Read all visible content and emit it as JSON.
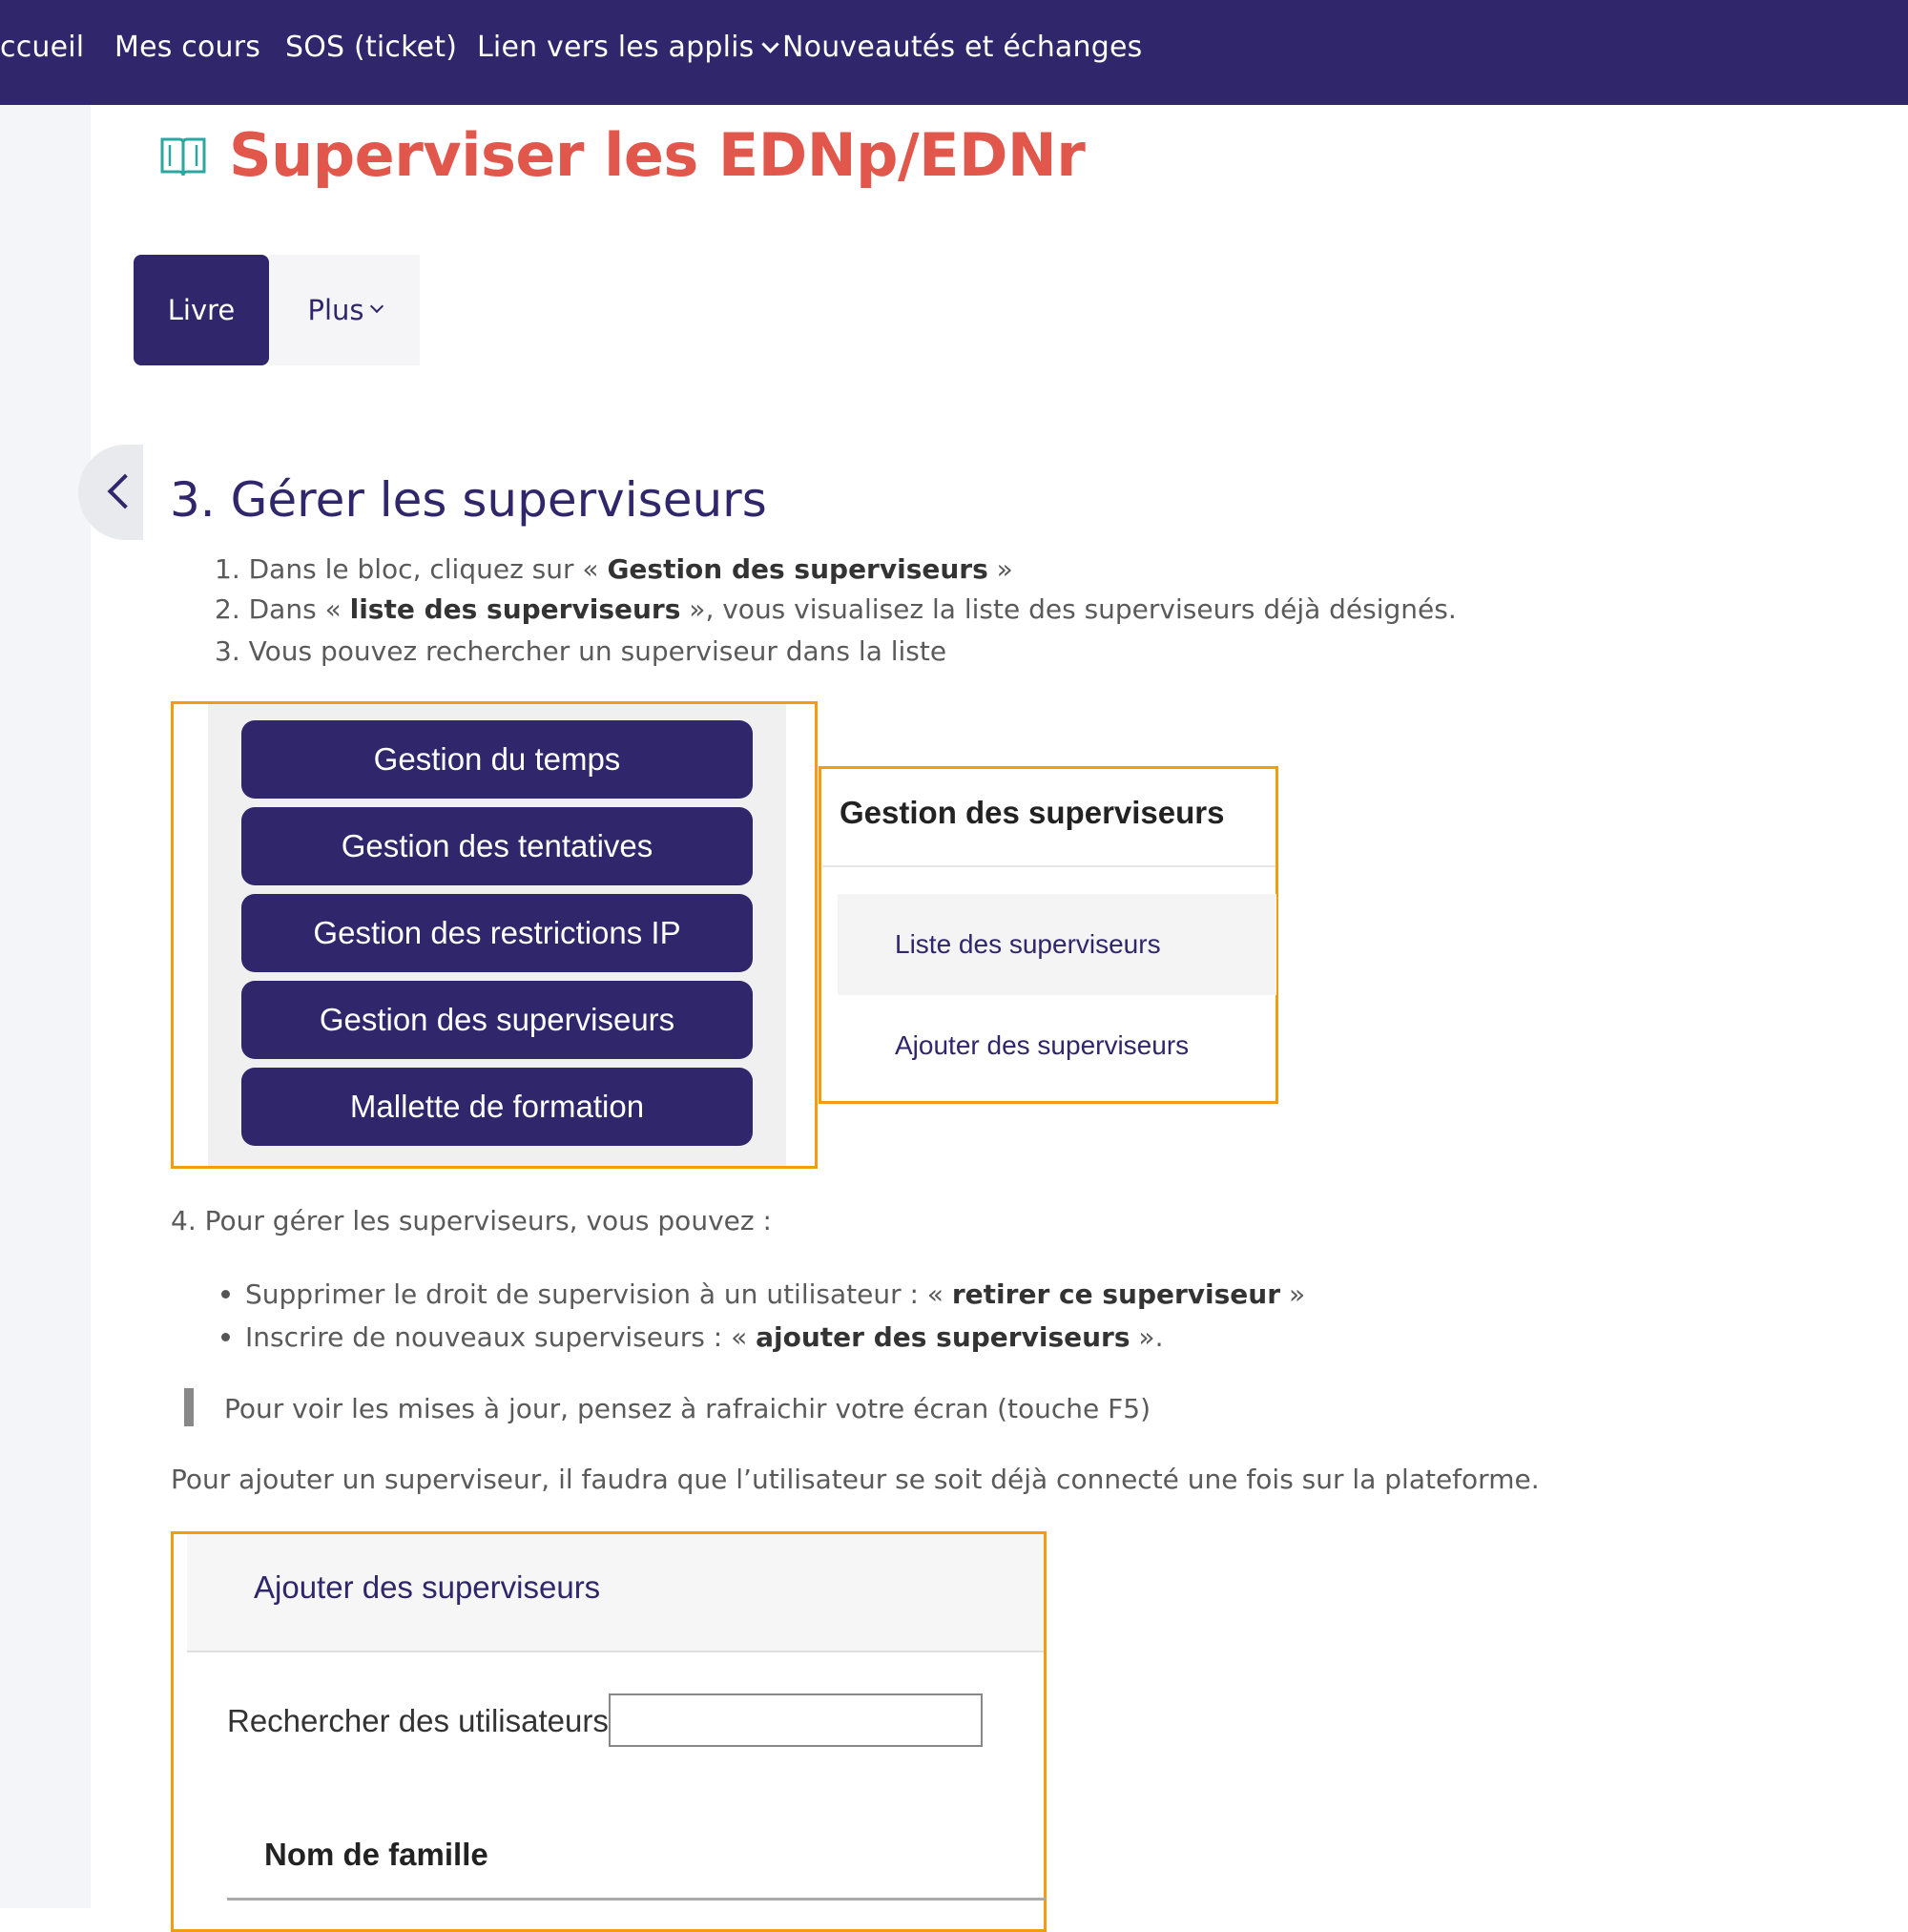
{
  "nav": {
    "items": [
      "ccueil",
      "Mes cours",
      "SOS (ticket)",
      "Lien vers les applis",
      "Nouveautés et échanges"
    ]
  },
  "page": {
    "title": "Superviser les EDNp/EDNr",
    "icon": "book-open-icon"
  },
  "tabs": {
    "livre": "Livre",
    "plus": "Plus"
  },
  "chapter": {
    "title": "3. Gérer les superviseurs",
    "steps": [
      {
        "num": "1.",
        "pre": "Dans le bloc, cliquez sur « ",
        "bold": "Gestion des superviseurs",
        "post": " »"
      },
      {
        "num": "2.",
        "pre": "Dans « ",
        "bold": "liste des superviseurs",
        "post": " », vous visualisez la liste des superviseurs déjà désignés."
      },
      {
        "num": "3.",
        "pre": "Vous pouvez rechercher un superviseur dans la liste",
        "bold": "",
        "post": ""
      }
    ],
    "step4": "4. Pour gérer les superviseurs, vous pouvez :",
    "bullets": [
      {
        "pre": "Supprimer le droit de supervision à un utilisateur : « ",
        "bold": "retirer ce superviseur",
        "post": " »"
      },
      {
        "pre": "Inscrire de nouveaux superviseurs : « ",
        "bold": "ajouter des superviseurs",
        "post": "  »."
      }
    ],
    "quote": "Pour voir les mises à jour, pensez à rafraichir votre écran (touche F5)",
    "note": "Pour ajouter un superviseur, il faudra que l’utilisateur se soit déjà connecté une fois sur la plateforme."
  },
  "screenshot1": {
    "buttons": [
      "Gestion du temps",
      "Gestion des tentatives",
      "Gestion des restrictions IP",
      "Gestion des superviseurs",
      "Mallette de formation"
    ]
  },
  "screenshot2": {
    "heading": "Gestion des superviseurs",
    "links": [
      "Liste des superviseurs",
      "Ajouter des superviseurs"
    ]
  },
  "screenshot3": {
    "heading": "Ajouter des superviseurs",
    "search_label": "Rechercher des utilisateurs",
    "search_value": "",
    "column": "Nom de famille"
  },
  "colors": {
    "navbar": "#30266b",
    "title": "#e2574c",
    "accent_border": "#f39c12"
  }
}
